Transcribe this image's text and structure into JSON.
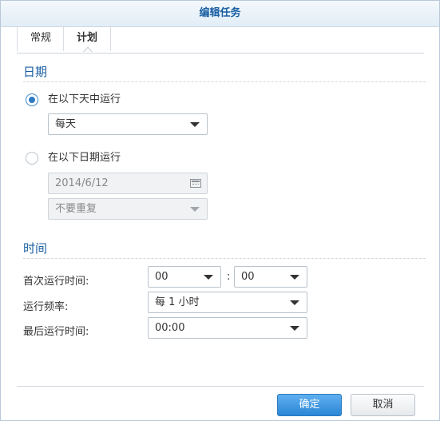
{
  "dialog": {
    "title": "编辑任务"
  },
  "tabs": [
    {
      "label": "常规"
    },
    {
      "label": "计划"
    }
  ],
  "date_section": {
    "title": "日期",
    "option_daily": {
      "label": "在以下天中运行",
      "selected": true,
      "select_value": "每天"
    },
    "option_date": {
      "label": "在以下日期运行",
      "selected": false,
      "date_value": "2014/6/12",
      "repeat_value": "不要重复"
    }
  },
  "time_section": {
    "title": "时间",
    "first_run": {
      "label": "首次运行时间:",
      "hour": "00",
      "minute": "00"
    },
    "frequency": {
      "label": "运行频率:",
      "value": "每 1 小时"
    },
    "last_run": {
      "label": "最后运行时间:",
      "value": "00:00"
    },
    "separator": ":"
  },
  "buttons": {
    "ok": "确定",
    "cancel": "取消"
  },
  "colors": {
    "accent": "#1a5fa3",
    "primary_button": "#2b86d6"
  }
}
